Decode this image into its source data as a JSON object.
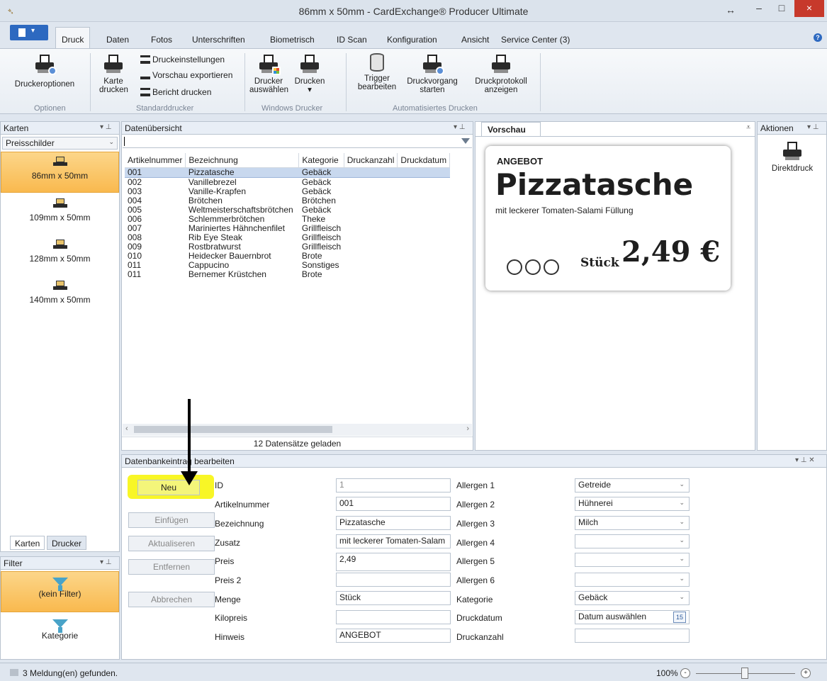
{
  "window": {
    "title": "86mm x 50mm - CardExchange® Producer Ultimate",
    "minimize": "–",
    "maximize": "□",
    "close": "×",
    "resize_glyph": "↔"
  },
  "ribbon_tabs": [
    "Druck",
    "Daten",
    "Fotos",
    "Unterschriften",
    "Biometrisch",
    "ID Scan",
    "Konfiguration",
    "Ansicht",
    "Service Center (3)"
  ],
  "ribbon": {
    "druckeroptionen": "Druckeroptionen",
    "karte_drucken_1": "Karte",
    "karte_drucken_2": "drucken",
    "druckeinstellungen": "Druckeinstellungen",
    "vorschau_exportieren": "Vorschau exportieren",
    "bericht_drucken": "Bericht drucken",
    "drucker_auswaehlen_1": "Drucker",
    "drucker_auswaehlen_2": "auswählen",
    "drucken": "Drucken",
    "drucken_caret": "▾",
    "trigger_1": "Trigger",
    "trigger_2": "bearbeiten",
    "druckvorgang_1": "Druckvorgang",
    "druckvorgang_2": "starten",
    "druckprotokoll_1": "Druckprotokoll",
    "druckprotokoll_2": "anzeigen",
    "groups": {
      "optionen": "Optionen",
      "standarddrucker": "Standarddrucker",
      "windows_drucker": "Windows Drucker",
      "automatisiert": "Automatisiertes Drucken"
    }
  },
  "karten_panel": {
    "title": "Karten",
    "combo_value": "Preisschilder",
    "items": [
      "86mm x 50mm",
      "109mm x 50mm",
      "128mm x 50mm",
      "140mm x 50mm"
    ],
    "bottom_tabs": [
      "Karten",
      "Drucker"
    ]
  },
  "filter_panel": {
    "title": "Filter",
    "items": [
      "(kein Filter)",
      "Kategorie"
    ]
  },
  "overview": {
    "title": "Datenübersicht",
    "columns": [
      "Artikelnummer",
      "Bezeichnung",
      "Kategorie",
      "Druckanzahl",
      "Druckdatum"
    ],
    "rows": [
      [
        "001",
        "Pizzatasche",
        "Gebäck"
      ],
      [
        "002",
        "Vanillebrezel",
        "Gebäck"
      ],
      [
        "003",
        "Vanille-Krapfen",
        "Gebäck"
      ],
      [
        "004",
        "Brötchen",
        "Brötchen"
      ],
      [
        "005",
        "Weltmeisterschaftsbrötchen",
        "Gebäck"
      ],
      [
        "006",
        "Schlemmerbrötchen",
        "Theke"
      ],
      [
        "007",
        "Mariniertes Hähnchenfilet",
        "Grillfleisch"
      ],
      [
        "008",
        "Rib Eye Steak",
        "Grillfleisch"
      ],
      [
        "009",
        "Rostbratwurst",
        "Grillfleisch"
      ],
      [
        "010",
        "Heidecker Bauernbrot",
        "Brote"
      ],
      [
        "011",
        "Cappucino",
        "Sonstiges"
      ],
      [
        "011",
        "Bernemer Krüstchen",
        "Brote"
      ]
    ],
    "status": "12 Datensätze geladen"
  },
  "preview": {
    "tab": "Vorschau",
    "angebot": "ANGEBOT",
    "title": "Pizzatasche",
    "subtitle": "mit leckerer Tomaten-Salami Füllung",
    "unit": "Stück",
    "price": "2,49 €"
  },
  "aktionen": {
    "title": "Aktionen",
    "direktdruck": "Direktdruck"
  },
  "edit": {
    "title": "Datenbankeintrag bearbeiten",
    "buttons": [
      "Neu",
      "Einfügen",
      "Aktualiseren",
      "Entfernen",
      "Abbrechen"
    ],
    "fields": [
      {
        "label": "ID",
        "value": "1"
      },
      {
        "label": "Artikelnummer",
        "value": "001"
      },
      {
        "label": "Bezeichnung",
        "value": "Pizzatasche"
      },
      {
        "label": "Zusatz",
        "value": "mit leckerer Tomaten-Salam"
      },
      {
        "label": "Preis",
        "value": "2,49"
      },
      {
        "label": "Preis 2",
        "value": ""
      },
      {
        "label": "Menge",
        "value": "Stück"
      },
      {
        "label": "Kilopreis",
        "value": ""
      },
      {
        "label": "Hinweis",
        "value": "ANGEBOT"
      }
    ],
    "right_fields": [
      {
        "label": "Allergen 1",
        "value": "Getreide"
      },
      {
        "label": "Allergen 2",
        "value": "Hühnerei"
      },
      {
        "label": "Allergen 3",
        "value": "Milch"
      },
      {
        "label": "Allergen 4",
        "value": ""
      },
      {
        "label": "Allergen 5",
        "value": ""
      },
      {
        "label": "Allergen 6",
        "value": ""
      },
      {
        "label": "Kategorie",
        "value": "Gebäck"
      },
      {
        "label": "Druckdatum",
        "value": "Datum auswählen"
      },
      {
        "label": "Druckanzahl",
        "value": ""
      }
    ],
    "calendar_day": "15"
  },
  "statusbar": {
    "message": "3 Meldung(en) gefunden.",
    "zoom": "100%",
    "zoom_minus": "-",
    "zoom_plus": "+"
  },
  "colors": {
    "accent": "#2d69c0",
    "selection": "#f9b94e",
    "highlight": "#f7f400"
  }
}
